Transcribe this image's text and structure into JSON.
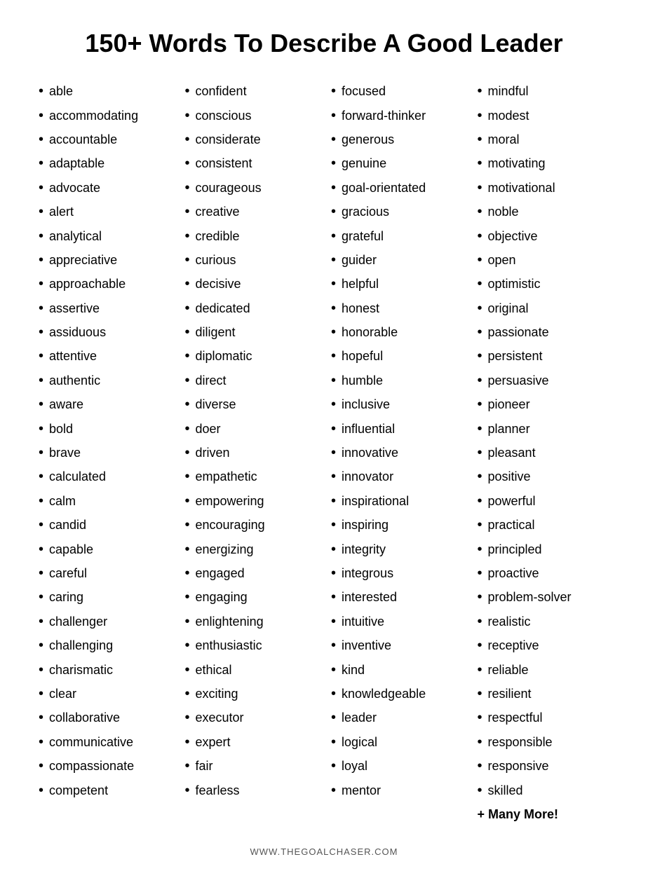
{
  "title": "150+ Words To Describe A Good Leader",
  "columns": [
    {
      "id": "col1",
      "words": [
        "able",
        "accommodating",
        "accountable",
        "adaptable",
        "advocate",
        "alert",
        "analytical",
        "appreciative",
        "approachable",
        "assertive",
        "assiduous",
        "attentive",
        "authentic",
        "aware",
        "bold",
        "brave",
        "calculated",
        "calm",
        "candid",
        "capable",
        "careful",
        "caring",
        "challenger",
        "challenging",
        "charismatic",
        "clear",
        "collaborative",
        "communicative",
        "compassionate",
        "competent"
      ]
    },
    {
      "id": "col2",
      "words": [
        "confident",
        "conscious",
        "considerate",
        "consistent",
        "courageous",
        "creative",
        "credible",
        "curious",
        "decisive",
        "dedicated",
        "diligent",
        "diplomatic",
        "direct",
        "diverse",
        "doer",
        "driven",
        "empathetic",
        "empowering",
        "encouraging",
        "energizing",
        "engaged",
        "engaging",
        "enlightening",
        "enthusiastic",
        "ethical",
        "exciting",
        "executor",
        "expert",
        "fair",
        "fearless"
      ]
    },
    {
      "id": "col3",
      "words": [
        "focused",
        "forward-thinker",
        "generous",
        "genuine",
        "goal-orientated",
        "gracious",
        "grateful",
        "guider",
        "helpful",
        "honest",
        "honorable",
        "hopeful",
        "humble",
        "inclusive",
        "influential",
        "innovative",
        "innovator",
        "inspirational",
        "inspiring",
        "integrity",
        "integrous",
        "interested",
        "intuitive",
        "inventive",
        "kind",
        "knowledgeable",
        "leader",
        "logical",
        "loyal",
        "mentor"
      ]
    },
    {
      "id": "col4",
      "words": [
        "mindful",
        "modest",
        "moral",
        "motivating",
        "motivational",
        "noble",
        "objective",
        "open",
        "optimistic",
        "original",
        "passionate",
        "persistent",
        "persuasive",
        "pioneer",
        "planner",
        "pleasant",
        "positive",
        "powerful",
        "practical",
        "principled",
        "proactive",
        "problem-solver",
        "realistic",
        "receptive",
        "reliable",
        "resilient",
        "respectful",
        "responsible",
        "responsive",
        "skilled"
      ],
      "extra": "+ Many More!"
    }
  ],
  "footer": "WWW.THEGOALCHASER.COM"
}
